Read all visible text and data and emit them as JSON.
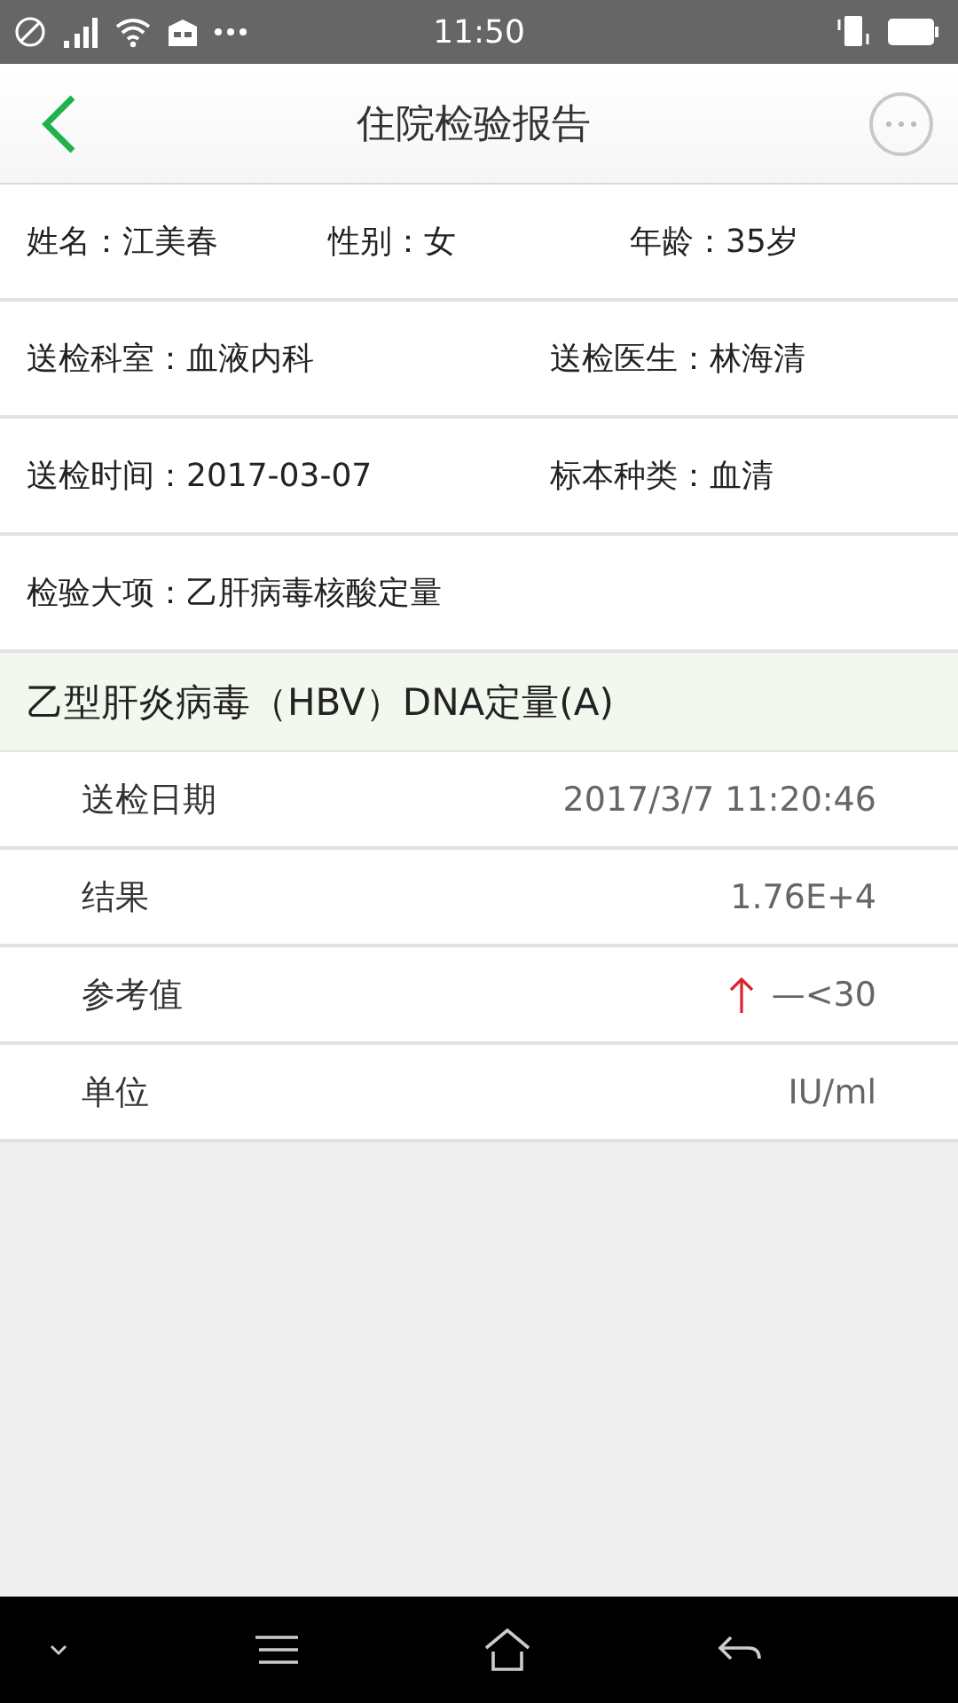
{
  "status_bar": {
    "time": "11:50"
  },
  "header": {
    "title": "住院检验报告"
  },
  "info_rows": [
    {
      "fields": [
        {
          "label": "姓名：",
          "value": "江美春"
        },
        {
          "label": "性别：",
          "value": "女"
        },
        {
          "label": "年龄：",
          "value": "35岁"
        }
      ]
    },
    {
      "fields": [
        {
          "label": "送检科室：",
          "value": "血液内科"
        },
        {
          "label": "送检医生：",
          "value": "林海清"
        }
      ]
    },
    {
      "fields": [
        {
          "label": "送检时间：",
          "value": "2017-03-07"
        },
        {
          "label": "标本种类：",
          "value": "血清"
        }
      ]
    },
    {
      "fields": [
        {
          "label": "检验大项：",
          "value": "乙肝病毒核酸定量"
        }
      ]
    }
  ],
  "section": {
    "title": "乙型肝炎病毒（HBV）DNA定量(A)",
    "rows": [
      {
        "label": "送检日期",
        "value": "2017/3/7 11:20:46",
        "high": false
      },
      {
        "label": "结果",
        "value": "1.76E+4",
        "high": false
      },
      {
        "label": "参考值",
        "value": "—<30",
        "high": true
      },
      {
        "label": "单位",
        "value": "IU/ml",
        "high": false
      }
    ]
  }
}
